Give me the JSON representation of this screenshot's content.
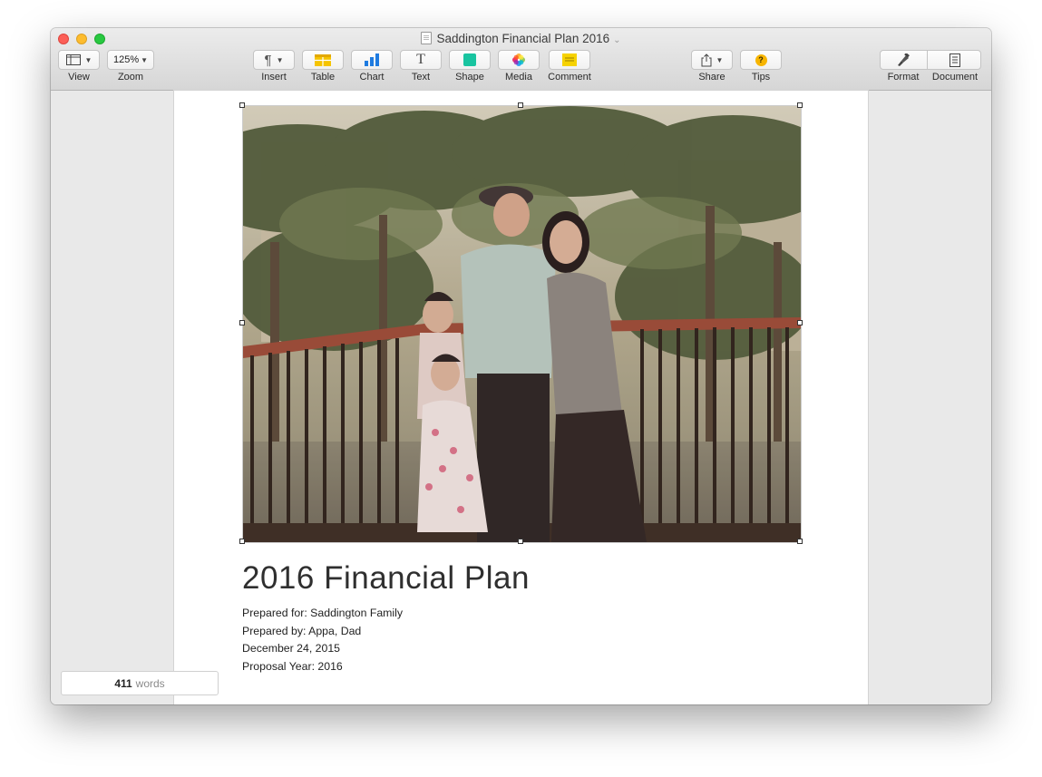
{
  "window": {
    "title": "Saddington Financial Plan 2016",
    "title_caret": "⌄"
  },
  "toolbar": {
    "view": {
      "label": "View"
    },
    "zoom": {
      "label": "Zoom",
      "value": "125%"
    },
    "insert": {
      "label": "Insert",
      "glyph": "¶"
    },
    "table": {
      "label": "Table"
    },
    "chart": {
      "label": "Chart"
    },
    "text": {
      "label": "Text",
      "glyph": "T"
    },
    "shape": {
      "label": "Shape"
    },
    "media": {
      "label": "Media"
    },
    "comment": {
      "label": "Comment"
    },
    "share": {
      "label": "Share"
    },
    "tips": {
      "label": "Tips",
      "glyph": "?"
    },
    "format": {
      "label": "Format"
    },
    "document": {
      "label": "Document"
    }
  },
  "document": {
    "title": "2016 Financial Plan",
    "lines": [
      "Prepared for: Saddington Family",
      "Prepared by: Appa, Dad",
      "December 24, 2015",
      "Proposal Year: 2016"
    ]
  },
  "status": {
    "word_count": "411",
    "word_label": "words"
  },
  "colors": {
    "accent_yellow": "#f6c400",
    "chart_blue": "#1e7be0",
    "shape_green": "#19c4a0",
    "tips_orange": "#f7b500"
  },
  "icons": {
    "view": "sidebar-view-icon",
    "table": "table-icon",
    "chart": "bar-chart-icon",
    "shape": "shape-square-icon",
    "media": "photos-flower-icon",
    "comment": "comment-note-icon",
    "share": "share-arrow-icon",
    "format": "paintbrush-icon",
    "document": "document-icon"
  }
}
